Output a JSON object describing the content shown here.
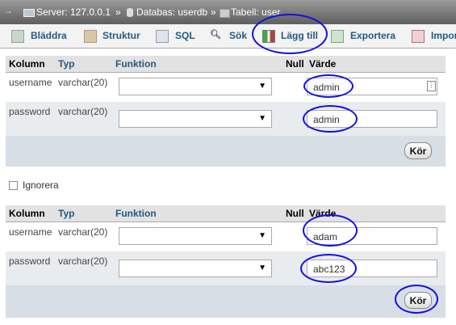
{
  "breadcrumb": {
    "server": "Server: 127.0.0.1",
    "sep1": "»",
    "database": "Databas: userdb",
    "sep2": "»",
    "table": "Tabell: user"
  },
  "tabs": [
    {
      "label": "Bläddra",
      "icon": "browse-icon"
    },
    {
      "label": "Struktur",
      "icon": "structure-icon"
    },
    {
      "label": "SQL",
      "icon": "sql-icon"
    },
    {
      "label": "Sök",
      "icon": "search-icon"
    },
    {
      "label": "Lägg till",
      "icon": "insert-icon",
      "active": true
    },
    {
      "label": "Exportera",
      "icon": "export-icon"
    },
    {
      "label": "Impor",
      "icon": "import-icon"
    }
  ],
  "columns": {
    "col": "Kolumn",
    "type": "Typ",
    "func": "Funktion",
    "null": "Null",
    "value": "Värde"
  },
  "form1": {
    "rows": [
      {
        "column": "username",
        "type": "varchar(20)",
        "value": "admin"
      },
      {
        "column": "password",
        "type": "varchar(20)",
        "value": "admin"
      }
    ],
    "go": "Kör"
  },
  "ignore_label": "Ignorera",
  "form2": {
    "rows": [
      {
        "column": "username",
        "type": "varchar(20)",
        "value": "adam"
      },
      {
        "column": "password",
        "type": "varchar(20)",
        "value": "abc123"
      }
    ],
    "go": "Kör"
  },
  "colors": {
    "annotation": "#1010e0",
    "tab_text": "#235a81"
  }
}
